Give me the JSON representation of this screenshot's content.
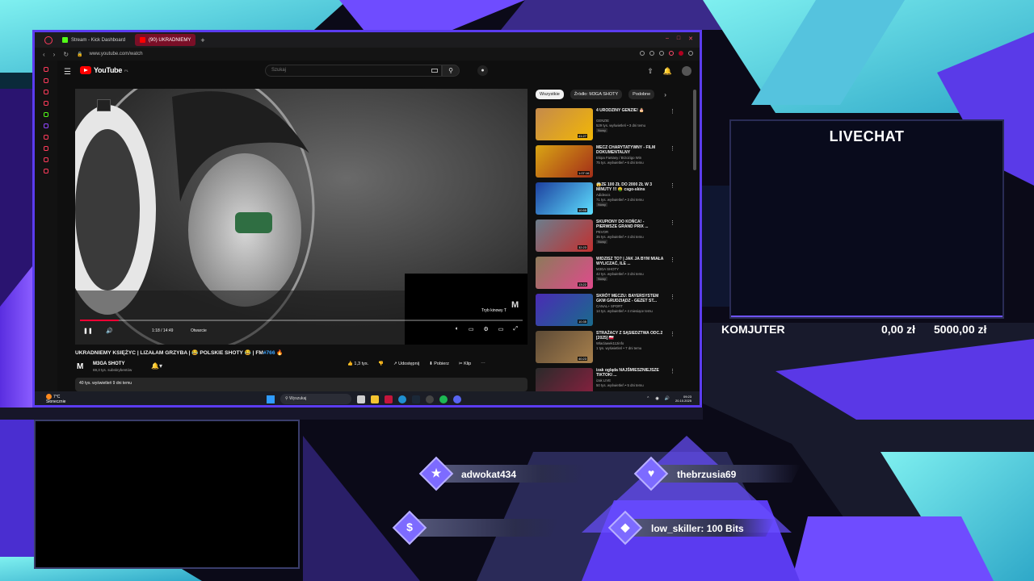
{
  "browser": {
    "tabs": [
      {
        "label": "Stream - Kick Dashboard",
        "active": false,
        "fav_color": "#53fc18"
      },
      {
        "label": "(90) UKRADNIEMY",
        "active": true,
        "fav_color": "#ff0000"
      }
    ],
    "url": "www.youtube.com/watch"
  },
  "youtube": {
    "logo_text": "YouTube",
    "logo_region": "PL",
    "search_placeholder": "Szukaj",
    "player": {
      "time": "1:18 / 14:49",
      "chapter": "Otwarcie",
      "progress_fraction": 0.088,
      "theater_tooltip": "Tryb kinowy",
      "tooltip_key": "T",
      "corner_logo": "M"
    },
    "video": {
      "title": "UKRADNIEMY KSIĘŻYC | LIZAŁAM GRZYBA | 😂 POLSKIE SHOTY 😂 | FM",
      "title_hash": "#766",
      "title_suffix": "🔥",
      "channel": "M3GA SHOTY",
      "subscribers": "69,3 tys. subskrybentów",
      "likes": "1,3 tys.",
      "share": "Udostępnij",
      "download": "Pobierz",
      "clip": "Klip",
      "description": "40 tys. wyświetleń  9 dni temu"
    },
    "chips": [
      "Wszystkie",
      "Źródło: M3GA SHOTY",
      "Podobne"
    ],
    "recommended": [
      {
        "title": "4 URODZINY GENZIE! 🎂",
        "channel": "GENZIE",
        "views": "529 tys. wyświetleń • 3 dni temu",
        "badge": "Nowy",
        "duration": "41:27",
        "color1": "#c58a4b",
        "color2": "#f2b705"
      },
      {
        "title": "MECZ CHARYTATYWNY - FILM DOKUMENTALNY",
        "channel": "Ekipa Fantasy / Brzozigo Win",
        "views": "75 tys. wyświetleń • 6 dni temu",
        "badge": "",
        "duration": "1:07:16",
        "color1": "#d9a514",
        "color2": "#a32d18"
      },
      {
        "title": "😱ZE 100 ZŁ DO 2000 ZŁ W 3 MINUTY !!! 🤑 csgo-skins",
        "channel": "Adidexcs",
        "views": "71 tys. wyświetleń • 3 dni temu",
        "badge": "Nowy",
        "duration": "10:55",
        "color1": "#1d3f9e",
        "color2": "#5ee0ff"
      },
      {
        "title": "SKUPIONY DO KOŃCA! - PIERWSZE GRAND PRIX ...",
        "channel": "PEVOR",
        "views": "35 tys. wyświetleń • 4 dni temu",
        "badge": "Nowy",
        "duration": "32:23",
        "color1": "#6b7d8c",
        "color2": "#c23030"
      },
      {
        "title": "WIDZISZ TO? | JAK JA BYM MIAŁA WYLICZAĆ, ILE ...",
        "channel": "M3GA SHOTY",
        "views": "42 tys. wyświetleń • 3 dni temu",
        "badge": "Nowy",
        "duration": "13:22",
        "color1": "#8c7a5a",
        "color2": "#e04a8c"
      },
      {
        "title": "SKRÓT MECZU: BAYERSYSTEM GKM GRUDZIĄDZ - GEZET ST...",
        "channel": "CANAL+ SPORT",
        "views": "14 tys. wyświetleń • 4 miesiące temu",
        "badge": "",
        "duration": "10:35",
        "color1": "#4a2bb5",
        "color2": "#1a6b8c"
      },
      {
        "title": "STRAŻACY Z SĄSIEDZTWA ODC.2 [2025] 🇵🇱",
        "channel": "Wlaclawek112info",
        "views": "1 tys. wyświetleń • 7 dni temu",
        "badge": "",
        "duration": "40:23",
        "color1": "#5c4a36",
        "color2": "#a8804c"
      },
      {
        "title": "izak ogląda NAJŚMIESZNIEJSZE TIKTOKI ...",
        "channel": "izak LIVE",
        "views": "50 tys. wyświetleń • 5 dni temu",
        "badge": "",
        "duration": "",
        "color1": "#2a2a2a",
        "color2": "#8c2040"
      }
    ]
  },
  "taskbar": {
    "weather_temp": "7°C",
    "weather_desc": "Słonecznie",
    "search": "Wyszukaj",
    "time": "09:23",
    "date": "20.10.2025"
  },
  "overlay": {
    "livechat_title": "LIVECHAT",
    "goal_name": "KOMJUTER",
    "goal_current": "0,00 zł",
    "goal_target": "5000,00 zł",
    "alerts": [
      {
        "symbol": "★",
        "text": "adwokat434"
      },
      {
        "symbol": "♥",
        "text": "thebrzusia69"
      },
      {
        "symbol": "$",
        "text": ""
      },
      {
        "symbol": "◆",
        "text": "low_skiller: 100 Bits"
      }
    ]
  }
}
